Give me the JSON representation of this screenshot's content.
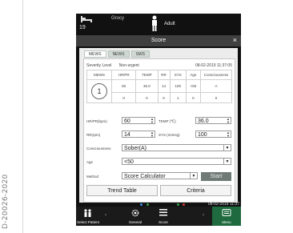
{
  "side_id": "D-20026-2020",
  "topbar": {
    "bed_number": "19",
    "patient_name": "Grocy",
    "patient_type": "Adult"
  },
  "window": {
    "title": "Score",
    "close_glyph": "×"
  },
  "tabs": [
    {
      "label": "MEWS",
      "active": true
    },
    {
      "label": "NEWS",
      "active": false
    },
    {
      "label": "SWS",
      "active": false
    }
  ],
  "severity": {
    "label": "Severity Level",
    "value": "Non-urgent",
    "datetime": "08-02-2019 11:37:05"
  },
  "score_table": {
    "headers": [
      "MEWS",
      "HR/PR",
      "TEMP",
      "RR",
      "SYS",
      "Age",
      "Consciousness"
    ],
    "score": "1",
    "values": [
      "60",
      "36.0",
      "14",
      "100",
      "<50",
      "A"
    ],
    "points": [
      "0",
      "0",
      "0",
      "1",
      "0",
      "0"
    ]
  },
  "form": {
    "hr_label": "HR/PR(bpm)",
    "hr_value": "60",
    "temp_label": "TEMP (℃)",
    "temp_value": "36.0",
    "rr_label": "RR(rpm)",
    "rr_value": "14",
    "sys_label": "SYS (mmHg)",
    "sys_value": "100",
    "consciousness_label": "Consciousness",
    "consciousness_value": "Sober(A)",
    "age_label": "Age",
    "age_value": "<50",
    "method_label": "Method",
    "method_value": "Score Calculator",
    "start_label": "Start",
    "trend_label": "Trend Table",
    "criteria_label": "Criteria"
  },
  "statusbar": {
    "time": "08-02-2019 11:37"
  },
  "nav": {
    "select_patient": "Select Patient",
    "general": "General",
    "score": "Score",
    "menu": "Menu"
  },
  "colors": {
    "menu_active": "#1f6a3e",
    "start_button": "#6f7a77"
  }
}
